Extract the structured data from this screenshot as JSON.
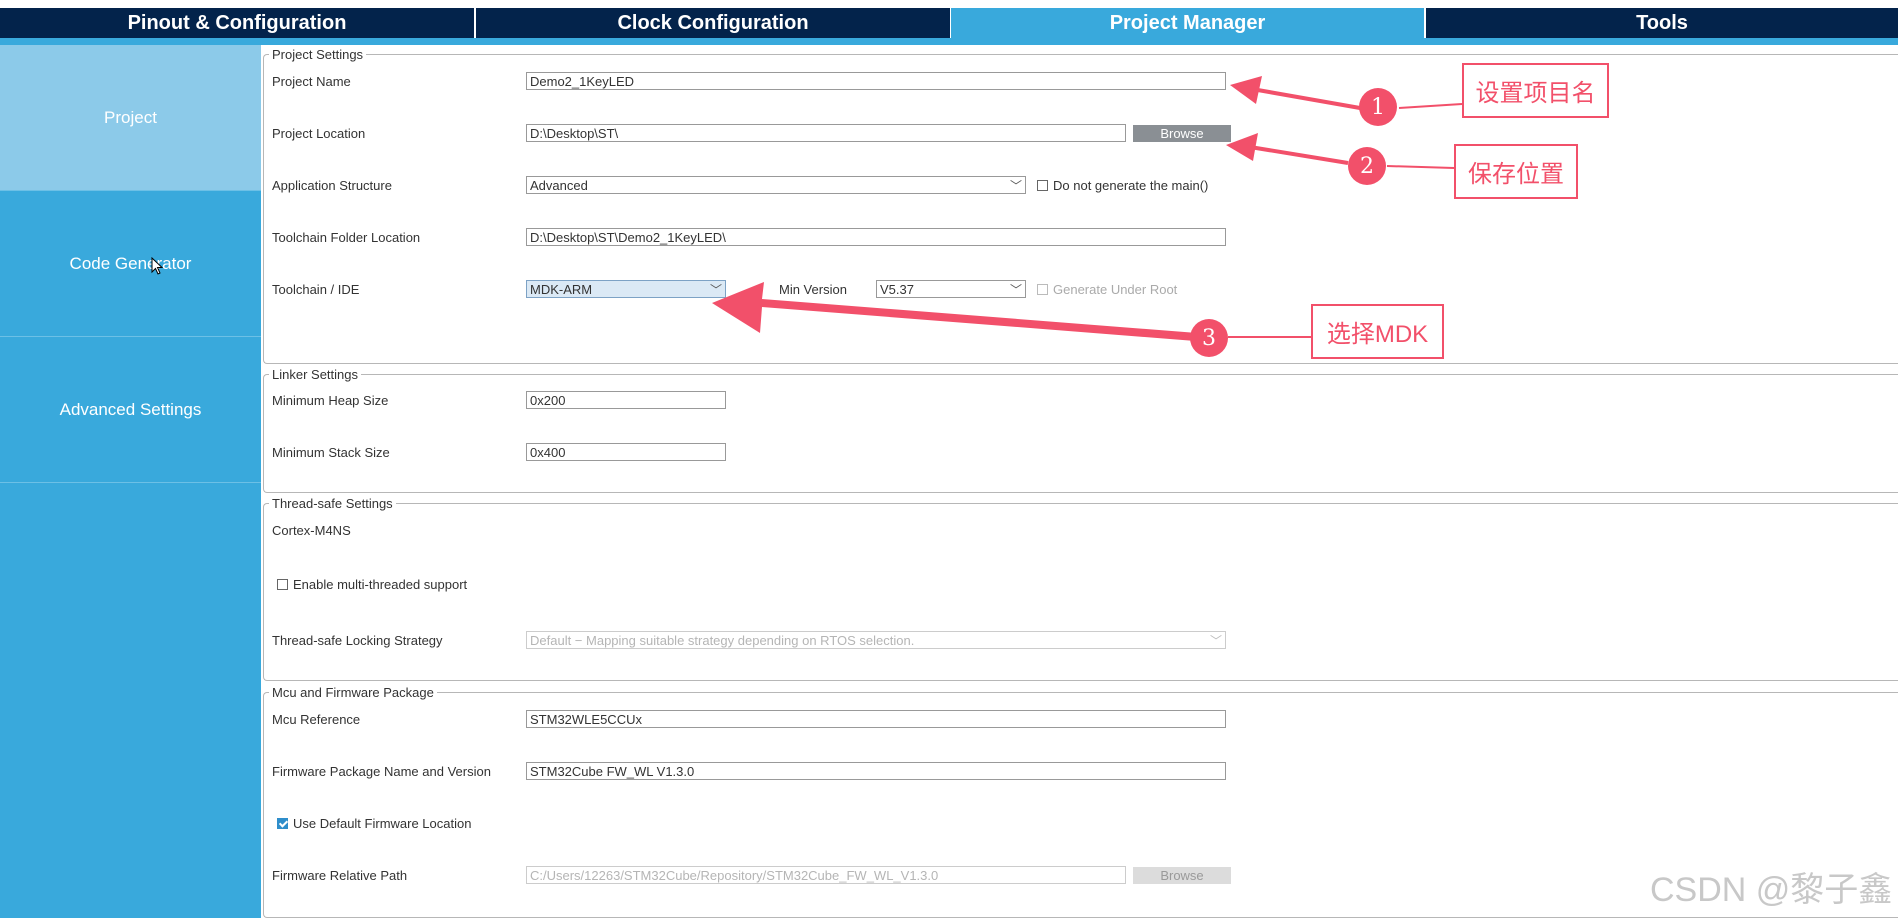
{
  "tabs": [
    {
      "label": "Pinout & Configuration"
    },
    {
      "label": "Clock Configuration"
    },
    {
      "label": "Project Manager"
    },
    {
      "label": "Tools"
    }
  ],
  "sidebar": {
    "items": [
      {
        "label": "Project"
      },
      {
        "label": "Code Generator"
      },
      {
        "label": "Advanced Settings"
      }
    ]
  },
  "project_settings": {
    "legend": "Project Settings",
    "project_name_label": "Project Name",
    "project_name_value": "Demo2_1KeyLED",
    "project_location_label": "Project Location",
    "project_location_value": "D:\\Desktop\\ST\\",
    "browse_label": "Browse",
    "app_structure_label": "Application Structure",
    "app_structure_value": "Advanced",
    "no_main_label": "Do not generate the main()",
    "toolchain_folder_label": "Toolchain Folder Location",
    "toolchain_folder_value": "D:\\Desktop\\ST\\Demo2_1KeyLED\\",
    "toolchain_ide_label": "Toolchain / IDE",
    "toolchain_ide_value": "MDK-ARM",
    "min_version_label": "Min Version",
    "min_version_value": "V5.37",
    "generate_under_root_label": "Generate Under Root"
  },
  "linker_settings": {
    "legend": "Linker Settings",
    "heap_label": "Minimum Heap Size",
    "heap_value": "0x200",
    "stack_label": "Minimum Stack Size",
    "stack_value": "0x400"
  },
  "thread_safe": {
    "legend": "Thread-safe Settings",
    "core_label": "Cortex-M4NS",
    "multithread_label": "Enable multi-threaded support",
    "locking_label": "Thread-safe Locking Strategy",
    "locking_value": "Default  −  Mapping suitable strategy depending on RTOS selection."
  },
  "mcu_firmware": {
    "legend": "Mcu and Firmware Package",
    "mcu_ref_label": "Mcu Reference",
    "mcu_ref_value": "STM32WLE5CCUx",
    "fw_name_label": "Firmware Package Name and Version",
    "fw_name_value": "STM32Cube FW_WL V1.3.0",
    "use_default_label": "Use Default Firmware Location",
    "fw_path_label": "Firmware Relative Path",
    "fw_path_value": "C:/Users/12263/STM32Cube/Repository/STM32Cube_FW_WL_V1.3.0",
    "browse_label": "Browse"
  },
  "annotations": [
    {
      "number": "1",
      "text": "设置项目名"
    },
    {
      "number": "2",
      "text": "保存位置"
    },
    {
      "number": "3",
      "text": "选择MDK"
    }
  ],
  "watermark": "CSDN @黎子鑫",
  "colors": {
    "nav_dark": "#03234b",
    "accent_blue": "#39a9dc",
    "sidebar_active": "#8ccae9",
    "annotation_red": "#f2506a"
  }
}
